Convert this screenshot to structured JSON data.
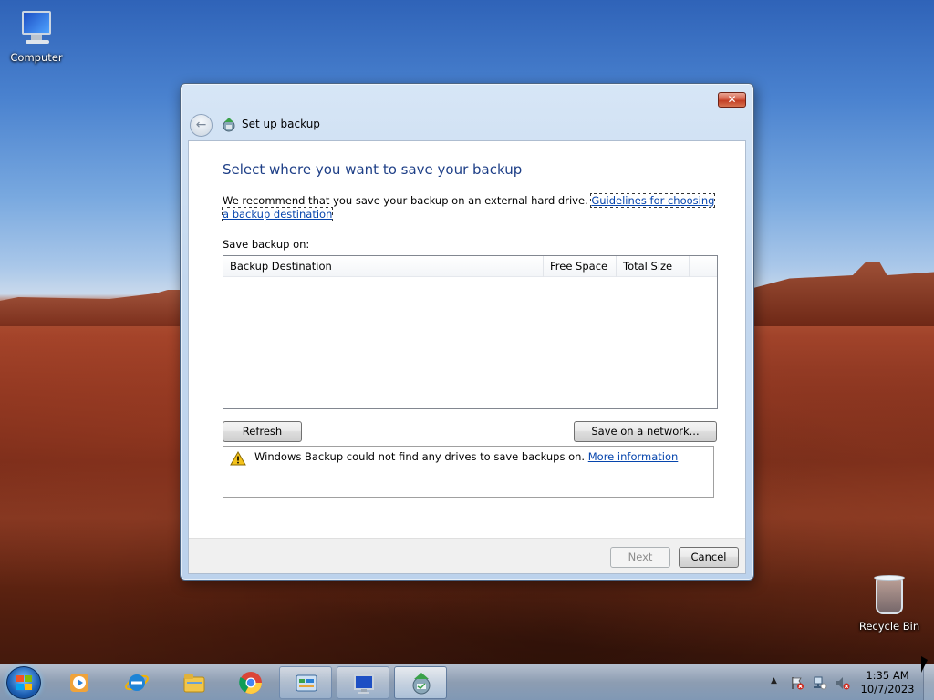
{
  "desktop": {
    "icons": [
      {
        "label": "Computer"
      },
      {
        "label": "Recycle Bin"
      }
    ]
  },
  "window": {
    "title": "Set up backup",
    "close_glyph": "✕",
    "back_glyph": "←",
    "heading": "Select where you want to save your backup",
    "recommendation": "We recommend that you save your backup on an external hard drive.",
    "guidelines_link": "Guidelines for choosing a backup destination",
    "save_on_label": "Save backup on:",
    "list": {
      "columns": [
        "Backup Destination",
        "Free Space",
        "Total Size"
      ],
      "rows": []
    },
    "refresh_button": "Refresh",
    "network_button": "Save on a network...",
    "warning": {
      "icon": "warning-icon",
      "text": "Windows Backup could not find any drives to save backups on.",
      "link": "More information"
    },
    "next_button": "Next",
    "cancel_button": "Cancel",
    "accent_color": "#1e3f87",
    "link_color": "#0645ad"
  },
  "taskbar": {
    "apps": [
      {
        "name": "windows-media-player-icon"
      },
      {
        "name": "internet-explorer-icon"
      },
      {
        "name": "windows-explorer-icon"
      },
      {
        "name": "chrome-icon"
      },
      {
        "name": "control-panel-icon"
      },
      {
        "name": "remote-desktop-icon"
      },
      {
        "name": "backup-and-restore-icon"
      }
    ],
    "tray_arrow": "▲",
    "time": "1:35 AM",
    "date": "10/7/2023"
  }
}
